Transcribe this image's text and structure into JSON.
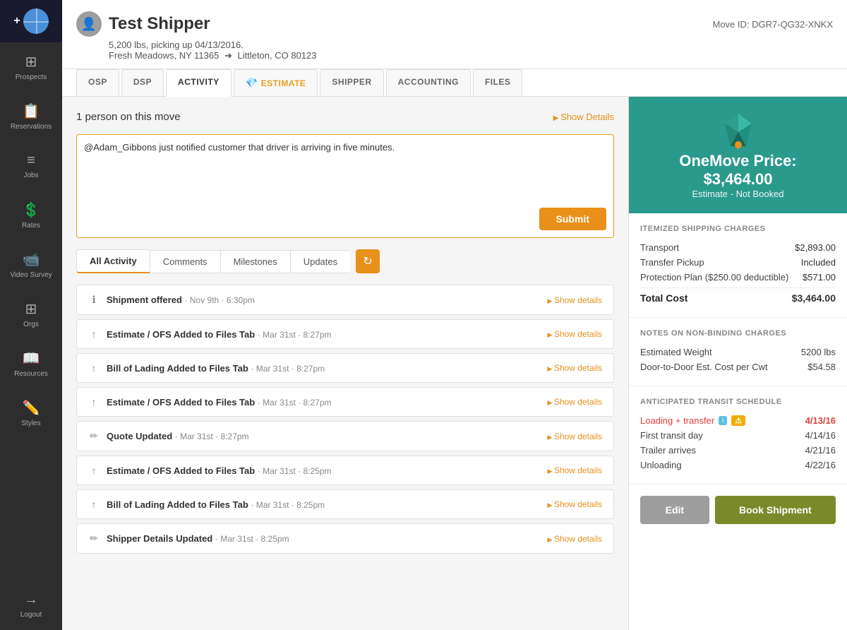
{
  "sidebar": {
    "items": [
      {
        "id": "prospects",
        "label": "Prospects",
        "icon": "⊞"
      },
      {
        "id": "reservations",
        "label": "Reservations",
        "icon": "📋"
      },
      {
        "id": "jobs",
        "label": "Jobs",
        "icon": "≡"
      },
      {
        "id": "rates",
        "label": "Rates",
        "icon": "💲"
      },
      {
        "id": "video-survey",
        "label": "Video Survey",
        "icon": "📹"
      },
      {
        "id": "orgs",
        "label": "Orgs",
        "icon": "⊞"
      },
      {
        "id": "resources",
        "label": "Resources",
        "icon": "📖"
      },
      {
        "id": "styles",
        "label": "Styles",
        "icon": "✏️"
      }
    ],
    "logout_label": "Logout",
    "logout_icon": "→"
  },
  "header": {
    "shipper_name": "Test Shipper",
    "move_id_label": "Move ID: DGR7-QG32-XNKX",
    "weight": "5,200 lbs, picking up 04/13/2016.",
    "origin": "Fresh Meadows, NY 11365",
    "destination": "Littleton, CO 80123"
  },
  "tabs": [
    {
      "id": "osp",
      "label": "OSP",
      "active": false
    },
    {
      "id": "dsp",
      "label": "DSP",
      "active": false
    },
    {
      "id": "activity",
      "label": "ACTIVITY",
      "active": true
    },
    {
      "id": "estimate",
      "label": "ESTIMATE",
      "active": false,
      "special": true
    },
    {
      "id": "shipper",
      "label": "SHIPPER",
      "active": false
    },
    {
      "id": "accounting",
      "label": "ACCOUNTING",
      "active": false
    },
    {
      "id": "files",
      "label": "FILES",
      "active": false
    }
  ],
  "activity": {
    "persons_label": "1 person on this move",
    "show_details_label": "Show Details",
    "comment_placeholder": "@Adam_Gibbons just notified customer that driver is arriving in five minutes.",
    "submit_label": "Submit",
    "filter_tabs": [
      {
        "id": "all",
        "label": "All Activity",
        "active": true
      },
      {
        "id": "comments",
        "label": "Comments",
        "active": false
      },
      {
        "id": "milestones",
        "label": "Milestones",
        "active": false
      },
      {
        "id": "updates",
        "label": "Updates",
        "active": false
      }
    ],
    "items": [
      {
        "icon": "ℹ",
        "title": "Shipment offered",
        "time": "· Nov 9th · 6:30pm",
        "show_details": "Show details"
      },
      {
        "icon": "↑",
        "title": "Estimate / OFS Added to Files Tab",
        "time": "· Mar 31st · 8:27pm",
        "show_details": "Show details"
      },
      {
        "icon": "↑",
        "title": "Bill of Lading Added to Files Tab",
        "time": "· Mar 31st · 8:27pm",
        "show_details": "Show details"
      },
      {
        "icon": "↑",
        "title": "Estimate / OFS Added to Files Tab",
        "time": "· Mar 31st · 8:27pm",
        "show_details": "Show details"
      },
      {
        "icon": "✏",
        "title": "Quote Updated",
        "time": "· Mar 31st · 8:27pm",
        "show_details": "Show details"
      },
      {
        "icon": "↑",
        "title": "Estimate / OFS Added to Files Tab",
        "time": "· Mar 31st · 8:25pm",
        "show_details": "Show details"
      },
      {
        "icon": "↑",
        "title": "Bill of Lading Added to Files Tab",
        "time": "· Mar 31st · 8:25pm",
        "show_details": "Show details"
      },
      {
        "icon": "✏",
        "title": "Shipper Details Updated",
        "time": "· Mar 31st · 8:25pm",
        "show_details": "Show details"
      }
    ]
  },
  "right_panel": {
    "onemove_price": "OneMove Price: $3,464.00",
    "onemove_status": "Estimate - Not Booked",
    "section_itemized": "Itemized Shipping Charges",
    "transport_label": "Transport",
    "transport_value": "$2,893.00",
    "transfer_pickup_label": "Transfer Pickup",
    "transfer_pickup_value": "Included",
    "protection_label": "Protection Plan ($250.00 deductible)",
    "protection_value": "$571.00",
    "total_label": "Total Cost",
    "total_value": "$3,464.00",
    "section_notes": "Notes on Non-binding Charges",
    "est_weight_label": "Estimated Weight",
    "est_weight_value": "5200 lbs",
    "door_to_door_label": "Door-to-Door Est. Cost per Cwt",
    "door_to_door_value": "$54.58",
    "section_transit": "Anticipated Transit Schedule",
    "loading_transfer_label": "Loading + transfer",
    "loading_transfer_value": "4/13/16",
    "first_transit_label": "First transit day",
    "first_transit_value": "4/14/16",
    "trailer_arrives_label": "Trailer arrives",
    "trailer_arrives_value": "4/21/16",
    "unloading_label": "Unloading",
    "unloading_value": "4/22/16",
    "edit_label": "Edit",
    "book_label": "Book Shipment"
  }
}
